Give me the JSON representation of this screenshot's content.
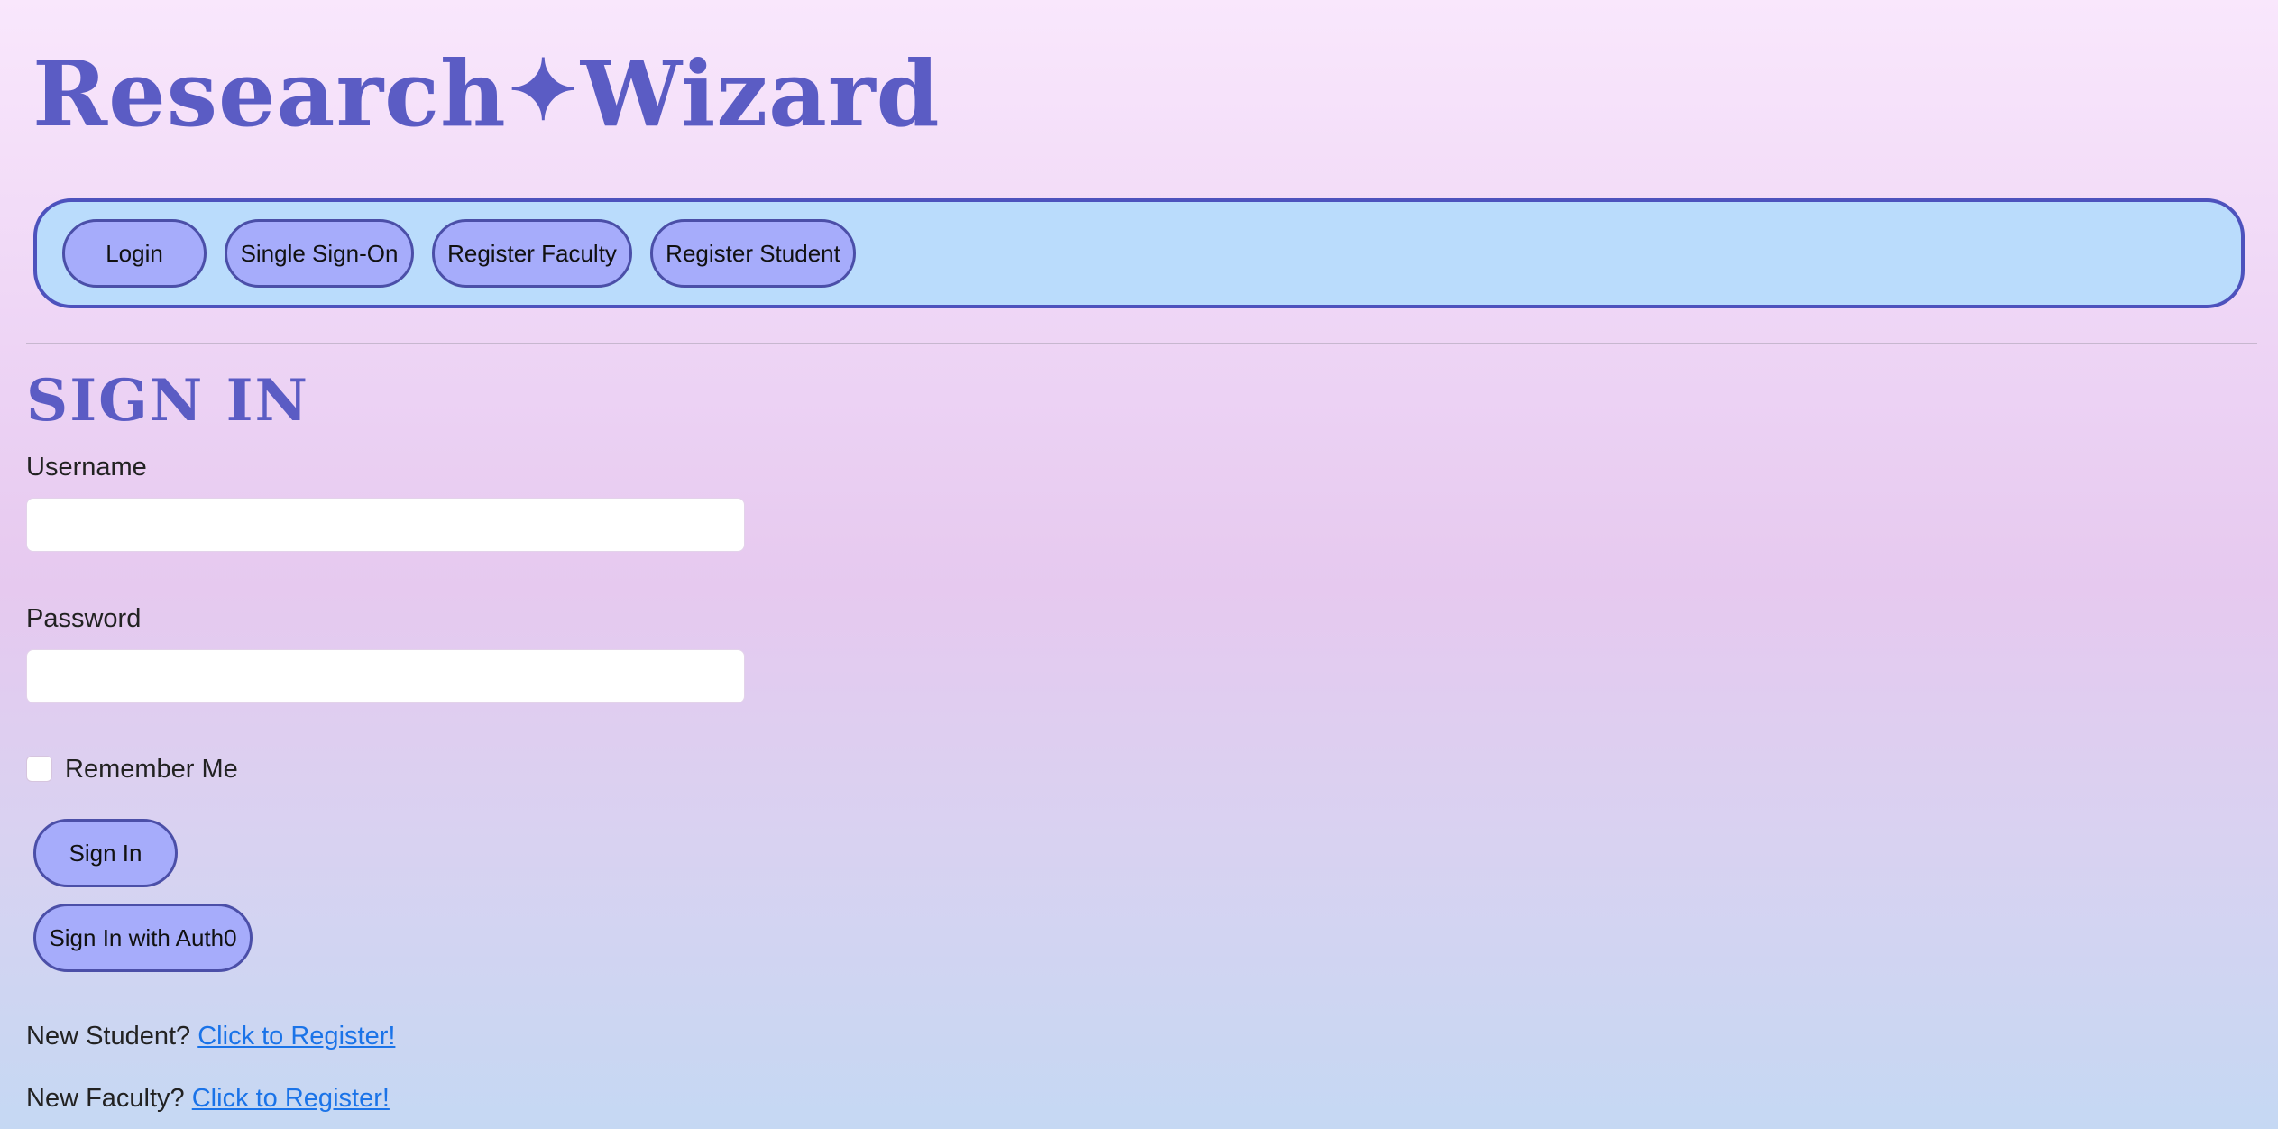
{
  "brand": {
    "name_left": "Research",
    "separator": "✦",
    "name_right": "Wizard",
    "color": "#5b5cc4"
  },
  "nav": {
    "items": [
      {
        "label": "Login"
      },
      {
        "label": "Single Sign-On"
      },
      {
        "label": "Register Faculty"
      },
      {
        "label": "Register Student"
      }
    ],
    "background": "#badcfc",
    "border": "#4d52bd",
    "button_fill": "#a6acfb"
  },
  "form": {
    "title": "SIGN IN",
    "username_label": "Username",
    "username_value": "",
    "password_label": "Password",
    "password_value": "",
    "remember_label": "Remember Me",
    "remember_checked": false,
    "signin_label": "Sign In",
    "auth0_label": "Sign In with Auth0"
  },
  "footer": {
    "student_prompt": "New Student?",
    "student_link": "Click to Register!",
    "faculty_prompt": "New Faculty?",
    "faculty_link": "Click to Register!",
    "link_color": "#1a73e8"
  }
}
